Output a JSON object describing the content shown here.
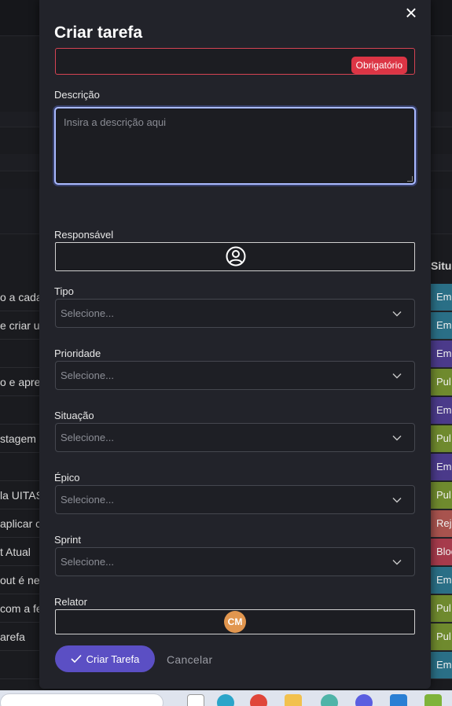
{
  "modal": {
    "title": "Criar tarefa",
    "close_symbol": "×",
    "title_field": {
      "value": "",
      "required_badge": "Obrigatório"
    },
    "description": {
      "label": "Descrição",
      "placeholder": "Insira a descrição aqui"
    },
    "assignee": {
      "label": "Responsável",
      "icon": "user-circle-icon"
    },
    "type": {
      "label": "Tipo",
      "placeholder": "Selecione..."
    },
    "priority": {
      "label": "Prioridade",
      "placeholder": "Selecione..."
    },
    "status": {
      "label": "Situação",
      "placeholder": "Selecione..."
    },
    "epic": {
      "label": "Épico",
      "placeholder": "Selecione..."
    },
    "sprint": {
      "label": "Sprint",
      "placeholder": "Selecione..."
    },
    "reporter": {
      "label": "Relator",
      "initials": "CM"
    },
    "actions": {
      "create_label": "Criar Tarefa",
      "cancel_label": "Cancelar"
    }
  },
  "background": {
    "column_header": "Situaç",
    "rows": [
      {
        "text": "o a cada",
        "status": "Em",
        "status_color": "#2a6f86"
      },
      {
        "text": "e criar u",
        "status": "Em",
        "status_color": "#2a6f86"
      },
      {
        "text": "",
        "status": "Em",
        "status_color": "#4b3a8a"
      },
      {
        "text": "o e apre",
        "status": "Pul",
        "status_color": "#6f8a2e"
      },
      {
        "text": "",
        "status": "Em",
        "status_color": "#4b3a8a"
      },
      {
        "text": "stagem",
        "status": "Pul",
        "status_color": "#6f8a2e"
      },
      {
        "text": "",
        "status": "Em",
        "status_color": "#4b3a8a"
      },
      {
        "text": "la UITAS",
        "status": "Pul",
        "status_color": "#6f8a2e"
      },
      {
        "text": "aplicar c",
        "status": "Reje",
        "status_color": "#a8534e"
      },
      {
        "text": "t Atual",
        "status": "Bloq",
        "status_color": "#a63b4c"
      },
      {
        "text": "out é ne",
        "status": "Em",
        "status_color": "#2a6f86"
      },
      {
        "text": "com a fe",
        "status": "Pul",
        "status_color": "#6f8a2e"
      },
      {
        "text": "arefa",
        "status": "Pul",
        "status_color": "#6f8a2e"
      },
      {
        "text": "",
        "status": "Em",
        "status_color": "#2a6f86"
      }
    ]
  }
}
